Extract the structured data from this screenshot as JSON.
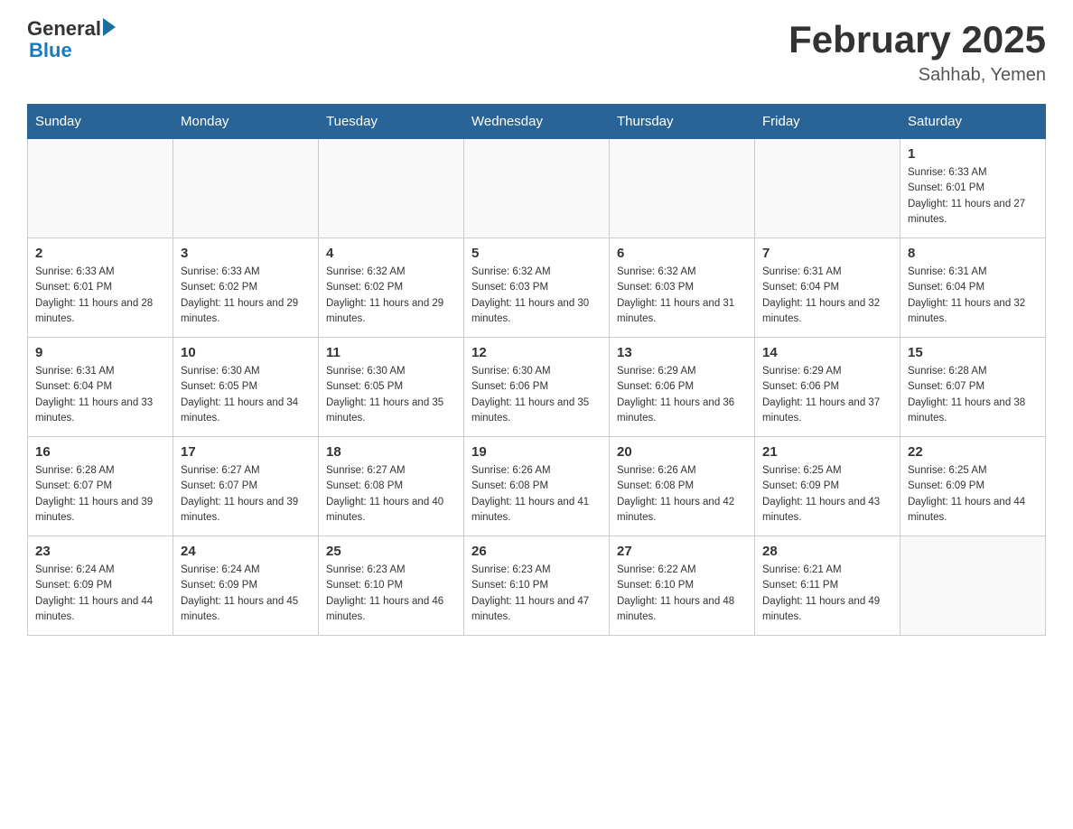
{
  "header": {
    "logo_text_general": "General",
    "logo_text_blue": "Blue",
    "month_title": "February 2025",
    "location": "Sahhab, Yemen"
  },
  "weekdays": [
    "Sunday",
    "Monday",
    "Tuesday",
    "Wednesday",
    "Thursday",
    "Friday",
    "Saturday"
  ],
  "weeks": [
    [
      {
        "day": "",
        "sunrise": "",
        "sunset": "",
        "daylight": ""
      },
      {
        "day": "",
        "sunrise": "",
        "sunset": "",
        "daylight": ""
      },
      {
        "day": "",
        "sunrise": "",
        "sunset": "",
        "daylight": ""
      },
      {
        "day": "",
        "sunrise": "",
        "sunset": "",
        "daylight": ""
      },
      {
        "day": "",
        "sunrise": "",
        "sunset": "",
        "daylight": ""
      },
      {
        "day": "",
        "sunrise": "",
        "sunset": "",
        "daylight": ""
      },
      {
        "day": "1",
        "sunrise": "Sunrise: 6:33 AM",
        "sunset": "Sunset: 6:01 PM",
        "daylight": "Daylight: 11 hours and 27 minutes."
      }
    ],
    [
      {
        "day": "2",
        "sunrise": "Sunrise: 6:33 AM",
        "sunset": "Sunset: 6:01 PM",
        "daylight": "Daylight: 11 hours and 28 minutes."
      },
      {
        "day": "3",
        "sunrise": "Sunrise: 6:33 AM",
        "sunset": "Sunset: 6:02 PM",
        "daylight": "Daylight: 11 hours and 29 minutes."
      },
      {
        "day": "4",
        "sunrise": "Sunrise: 6:32 AM",
        "sunset": "Sunset: 6:02 PM",
        "daylight": "Daylight: 11 hours and 29 minutes."
      },
      {
        "day": "5",
        "sunrise": "Sunrise: 6:32 AM",
        "sunset": "Sunset: 6:03 PM",
        "daylight": "Daylight: 11 hours and 30 minutes."
      },
      {
        "day": "6",
        "sunrise": "Sunrise: 6:32 AM",
        "sunset": "Sunset: 6:03 PM",
        "daylight": "Daylight: 11 hours and 31 minutes."
      },
      {
        "day": "7",
        "sunrise": "Sunrise: 6:31 AM",
        "sunset": "Sunset: 6:04 PM",
        "daylight": "Daylight: 11 hours and 32 minutes."
      },
      {
        "day": "8",
        "sunrise": "Sunrise: 6:31 AM",
        "sunset": "Sunset: 6:04 PM",
        "daylight": "Daylight: 11 hours and 32 minutes."
      }
    ],
    [
      {
        "day": "9",
        "sunrise": "Sunrise: 6:31 AM",
        "sunset": "Sunset: 6:04 PM",
        "daylight": "Daylight: 11 hours and 33 minutes."
      },
      {
        "day": "10",
        "sunrise": "Sunrise: 6:30 AM",
        "sunset": "Sunset: 6:05 PM",
        "daylight": "Daylight: 11 hours and 34 minutes."
      },
      {
        "day": "11",
        "sunrise": "Sunrise: 6:30 AM",
        "sunset": "Sunset: 6:05 PM",
        "daylight": "Daylight: 11 hours and 35 minutes."
      },
      {
        "day": "12",
        "sunrise": "Sunrise: 6:30 AM",
        "sunset": "Sunset: 6:06 PM",
        "daylight": "Daylight: 11 hours and 35 minutes."
      },
      {
        "day": "13",
        "sunrise": "Sunrise: 6:29 AM",
        "sunset": "Sunset: 6:06 PM",
        "daylight": "Daylight: 11 hours and 36 minutes."
      },
      {
        "day": "14",
        "sunrise": "Sunrise: 6:29 AM",
        "sunset": "Sunset: 6:06 PM",
        "daylight": "Daylight: 11 hours and 37 minutes."
      },
      {
        "day": "15",
        "sunrise": "Sunrise: 6:28 AM",
        "sunset": "Sunset: 6:07 PM",
        "daylight": "Daylight: 11 hours and 38 minutes."
      }
    ],
    [
      {
        "day": "16",
        "sunrise": "Sunrise: 6:28 AM",
        "sunset": "Sunset: 6:07 PM",
        "daylight": "Daylight: 11 hours and 39 minutes."
      },
      {
        "day": "17",
        "sunrise": "Sunrise: 6:27 AM",
        "sunset": "Sunset: 6:07 PM",
        "daylight": "Daylight: 11 hours and 39 minutes."
      },
      {
        "day": "18",
        "sunrise": "Sunrise: 6:27 AM",
        "sunset": "Sunset: 6:08 PM",
        "daylight": "Daylight: 11 hours and 40 minutes."
      },
      {
        "day": "19",
        "sunrise": "Sunrise: 6:26 AM",
        "sunset": "Sunset: 6:08 PM",
        "daylight": "Daylight: 11 hours and 41 minutes."
      },
      {
        "day": "20",
        "sunrise": "Sunrise: 6:26 AM",
        "sunset": "Sunset: 6:08 PM",
        "daylight": "Daylight: 11 hours and 42 minutes."
      },
      {
        "day": "21",
        "sunrise": "Sunrise: 6:25 AM",
        "sunset": "Sunset: 6:09 PM",
        "daylight": "Daylight: 11 hours and 43 minutes."
      },
      {
        "day": "22",
        "sunrise": "Sunrise: 6:25 AM",
        "sunset": "Sunset: 6:09 PM",
        "daylight": "Daylight: 11 hours and 44 minutes."
      }
    ],
    [
      {
        "day": "23",
        "sunrise": "Sunrise: 6:24 AM",
        "sunset": "Sunset: 6:09 PM",
        "daylight": "Daylight: 11 hours and 44 minutes."
      },
      {
        "day": "24",
        "sunrise": "Sunrise: 6:24 AM",
        "sunset": "Sunset: 6:09 PM",
        "daylight": "Daylight: 11 hours and 45 minutes."
      },
      {
        "day": "25",
        "sunrise": "Sunrise: 6:23 AM",
        "sunset": "Sunset: 6:10 PM",
        "daylight": "Daylight: 11 hours and 46 minutes."
      },
      {
        "day": "26",
        "sunrise": "Sunrise: 6:23 AM",
        "sunset": "Sunset: 6:10 PM",
        "daylight": "Daylight: 11 hours and 47 minutes."
      },
      {
        "day": "27",
        "sunrise": "Sunrise: 6:22 AM",
        "sunset": "Sunset: 6:10 PM",
        "daylight": "Daylight: 11 hours and 48 minutes."
      },
      {
        "day": "28",
        "sunrise": "Sunrise: 6:21 AM",
        "sunset": "Sunset: 6:11 PM",
        "daylight": "Daylight: 11 hours and 49 minutes."
      },
      {
        "day": "",
        "sunrise": "",
        "sunset": "",
        "daylight": ""
      }
    ]
  ]
}
